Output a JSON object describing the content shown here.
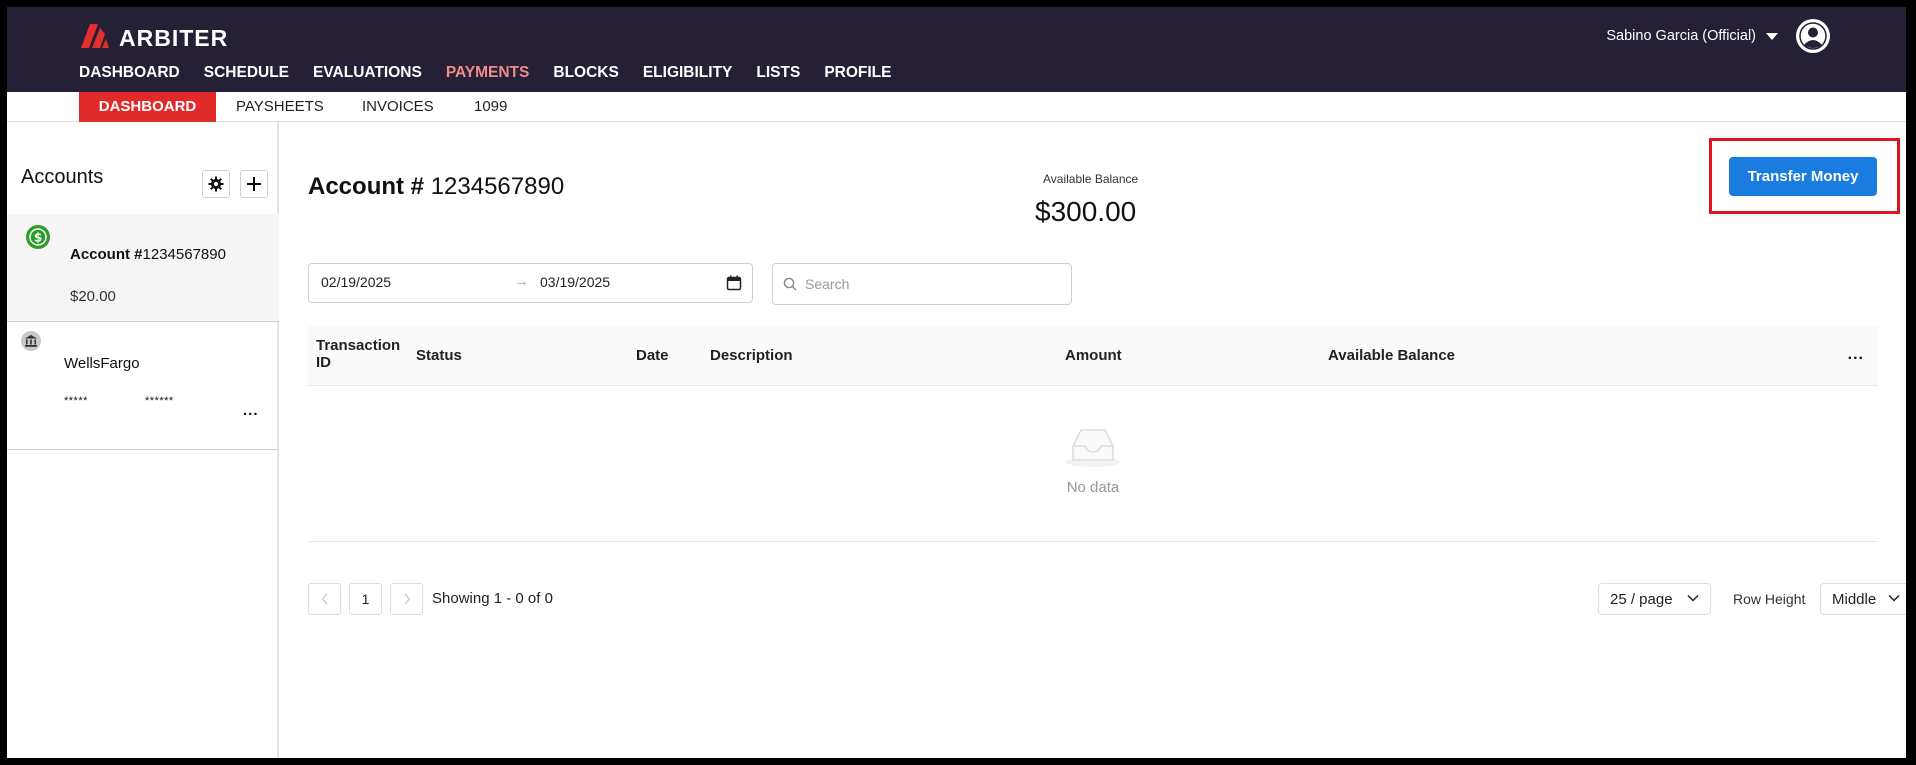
{
  "app": {
    "brand": "ARBITER"
  },
  "header": {
    "user_name": "Sabino Garcia (Official)",
    "nav": [
      {
        "label": "DASHBOARD"
      },
      {
        "label": "SCHEDULE"
      },
      {
        "label": "EVALUATIONS"
      },
      {
        "label": "PAYMENTS",
        "active": true
      },
      {
        "label": "BLOCKS"
      },
      {
        "label": "ELIGIBILITY"
      },
      {
        "label": "LISTS"
      },
      {
        "label": "PROFILE"
      }
    ]
  },
  "subnav": [
    {
      "label": "DASHBOARD",
      "active": true
    },
    {
      "label": "PAYSHEETS"
    },
    {
      "label": "INVOICES"
    },
    {
      "label": "1099"
    }
  ],
  "sidebar": {
    "title": "Accounts",
    "accounts": [
      {
        "prefix": "Account #",
        "number": "1234567890",
        "balance": "$20.00"
      }
    ],
    "banks": [
      {
        "name": "WellsFargo",
        "mask_1": "*****",
        "mask_2": "******",
        "more": "..."
      }
    ]
  },
  "main": {
    "account_prefix": "Account #",
    "account_number": "1234567890",
    "available_balance_label": "Available Balance",
    "available_balance": "$300.00",
    "transfer_button": "Transfer Money",
    "date_from": "02/19/2025",
    "date_arrow": "→",
    "date_to": "03/19/2025",
    "search_placeholder": "Search",
    "table": {
      "columns": [
        "Transaction ID",
        "Status",
        "Date",
        "Description",
        "Amount",
        "Available Balance"
      ],
      "more": "...",
      "empty_text": "No data"
    },
    "pagination": {
      "current_page": "1",
      "showing": "Showing 1 - 0 of 0",
      "per_page": "25 / page",
      "row_height_label": "Row Height",
      "row_height_value": "Middle"
    }
  },
  "colors": {
    "header_bg": "#262036",
    "nav_active": "#f08b8b",
    "subnav_active_bg": "#e12a2a",
    "primary_button": "#1a7ce0",
    "highlight_box": "#e0141e",
    "account_icon": "#2c9c2c"
  }
}
